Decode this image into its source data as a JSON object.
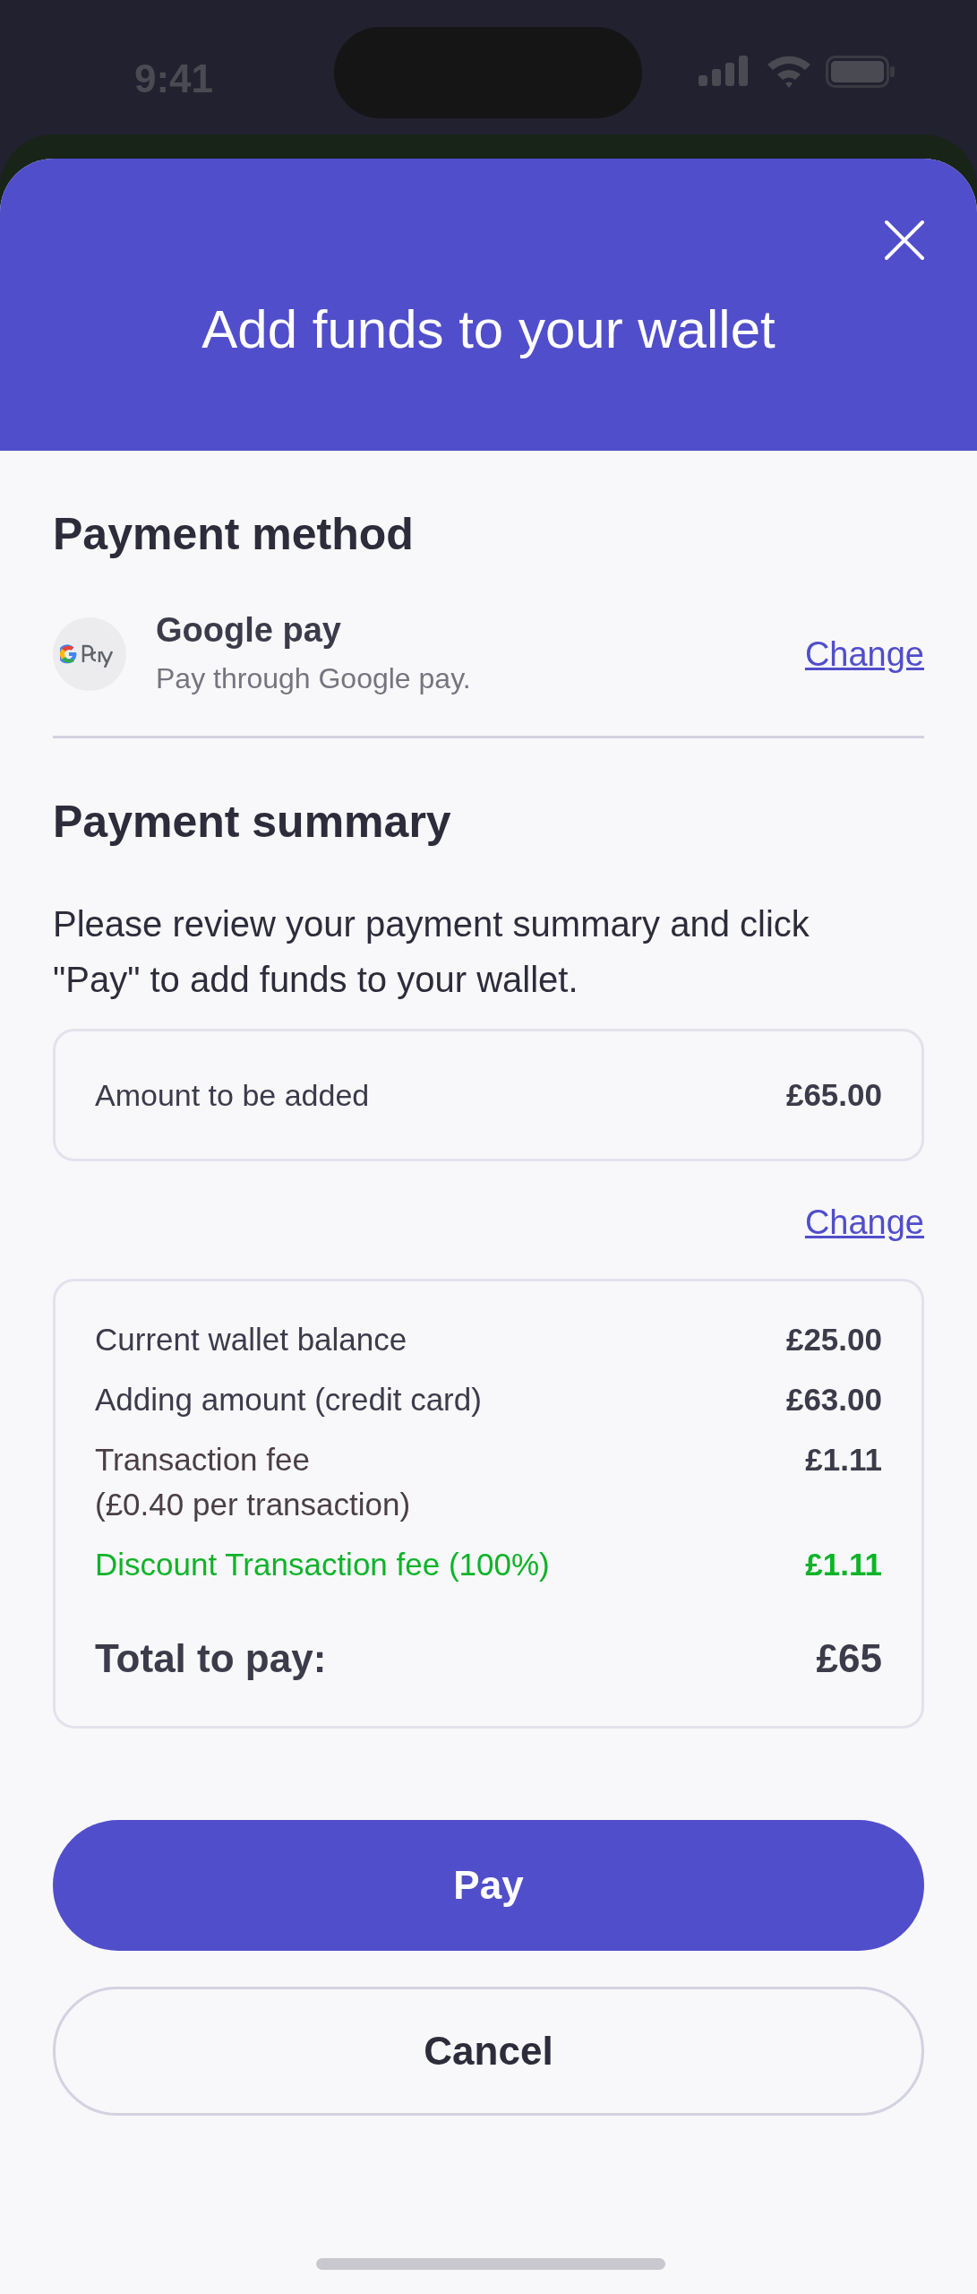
{
  "status_bar": {
    "time": "9:41"
  },
  "header": {
    "title": "Add funds to your wallet"
  },
  "payment_method": {
    "heading": "Payment method",
    "name": "Google pay",
    "description": "Pay through Google pay.",
    "change_link": "Change"
  },
  "payment_summary": {
    "heading": "Payment summary",
    "intro": "Please review your payment summary and click \"Pay\" to add funds to your wallet.",
    "amount": {
      "label": "Amount to be added",
      "value": "£65.00"
    },
    "change_link": "Change",
    "lines": [
      {
        "kind": "normal",
        "label": "Current wallet balance",
        "value": "£25.00"
      },
      {
        "kind": "normal",
        "label": "Adding amount (credit card)",
        "value": "£63.00"
      },
      {
        "kind": "fee",
        "label": "Transaction fee",
        "note": "(£0.40 per transaction)",
        "value": "£1.11"
      },
      {
        "kind": "discount",
        "label": "Discount Transaction fee (100%)",
        "value": "£1.11"
      }
    ],
    "total": {
      "label": "Total to pay:",
      "value": "£65"
    }
  },
  "buttons": [
    {
      "kind": "primary",
      "label": "Pay"
    },
    {
      "kind": "secondary",
      "label": "Cancel"
    }
  ]
}
